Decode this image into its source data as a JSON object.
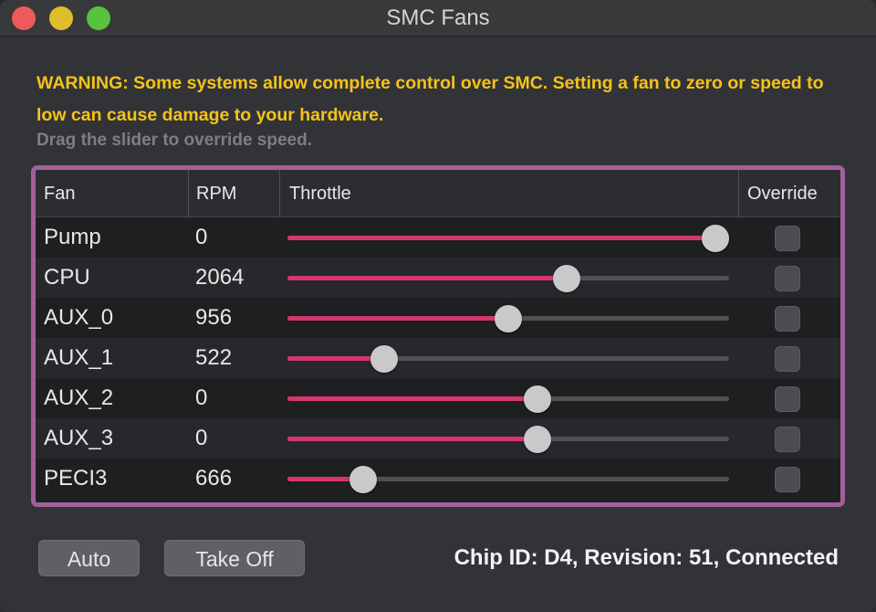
{
  "window": {
    "title": "SMC Fans"
  },
  "warning": "WARNING: Some systems allow complete control over SMC. Setting a fan to zero or speed to low can cause damage to your hardware.",
  "hint": "Drag the slider to override speed.",
  "table": {
    "headers": {
      "fan": "Fan",
      "rpm": "RPM",
      "throttle": "Throttle",
      "override": "Override"
    },
    "rows": [
      {
        "name": "Pump",
        "rpm": "0",
        "throttle": 1.0,
        "override": false
      },
      {
        "name": "CPU",
        "rpm": "2064",
        "throttle": 0.64,
        "override": false
      },
      {
        "name": "AUX_0",
        "rpm": "956",
        "throttle": 0.5,
        "override": false
      },
      {
        "name": "AUX_1",
        "rpm": "522",
        "throttle": 0.2,
        "override": false
      },
      {
        "name": "AUX_2",
        "rpm": "0",
        "throttle": 0.57,
        "override": false
      },
      {
        "name": "AUX_3",
        "rpm": "0",
        "throttle": 0.57,
        "override": false
      },
      {
        "name": "PECI3",
        "rpm": "666",
        "throttle": 0.15,
        "override": false
      }
    ]
  },
  "buttons": {
    "auto": "Auto",
    "take_off": "Take Off"
  },
  "status": "Chip ID: D4, Revision: 51, Connected",
  "colors": {
    "accent": "#d6366f",
    "frame": "#a2609a",
    "warning": "#f4c31b"
  }
}
